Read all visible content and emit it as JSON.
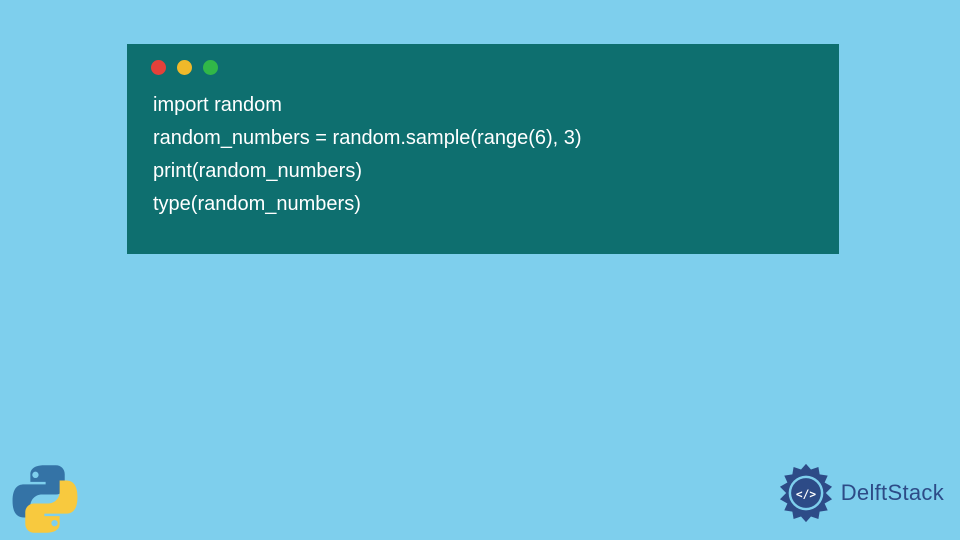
{
  "code": {
    "lines": [
      "import random",
      "random_numbers = random.sample(range(6), 3)",
      "print(random_numbers)",
      "type(random_numbers)"
    ]
  },
  "branding": {
    "delft_text": "DelftStack"
  },
  "colors": {
    "background": "#7ecfed",
    "window": "#0e6f6f",
    "dot_red": "#e4413a",
    "dot_yellow": "#f0b92a",
    "dot_green": "#31b748",
    "delft_blue": "#2d4b87",
    "python_blue": "#3473a6",
    "python_yellow": "#f8c93e"
  }
}
